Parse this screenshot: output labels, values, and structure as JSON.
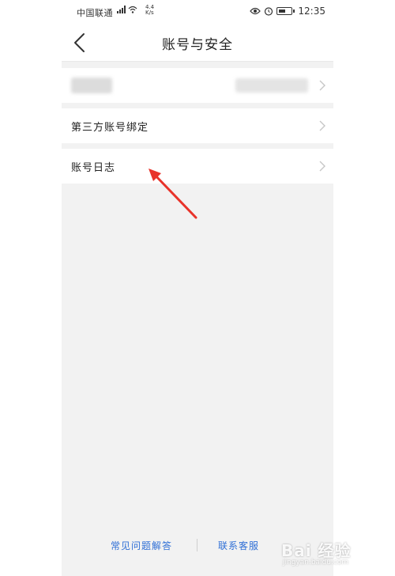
{
  "status_bar": {
    "carrier": "中国联通",
    "net_speed_value": "4.4",
    "net_speed_unit": "K/s",
    "battery": "75",
    "time": "12:35",
    "icons": [
      "signal-icon",
      "wifi-icon",
      "eye-icon",
      "alarm-icon",
      "battery-icon"
    ]
  },
  "nav": {
    "back_icon": "chevron-left-icon",
    "title": "账号与安全"
  },
  "menu": {
    "items": [
      {
        "label": "",
        "value": "",
        "icon": "chevron-right-icon",
        "blurred": true
      },
      {
        "label": "第三方账号绑定",
        "icon": "chevron-right-icon"
      },
      {
        "label": "账号日志",
        "icon": "chevron-right-icon"
      }
    ]
  },
  "annotation": {
    "icon": "red-arrow-icon",
    "color": "#e8332a"
  },
  "footer": {
    "faq_label": "常见问题解答",
    "contact_label": "联系客服"
  },
  "watermark": {
    "text": "Bai 经验",
    "sub": "jingyan.baidu.com"
  },
  "colors": {
    "background": "#f2f2f2",
    "link": "#2f6fd6",
    "annotation": "#e8332a"
  }
}
